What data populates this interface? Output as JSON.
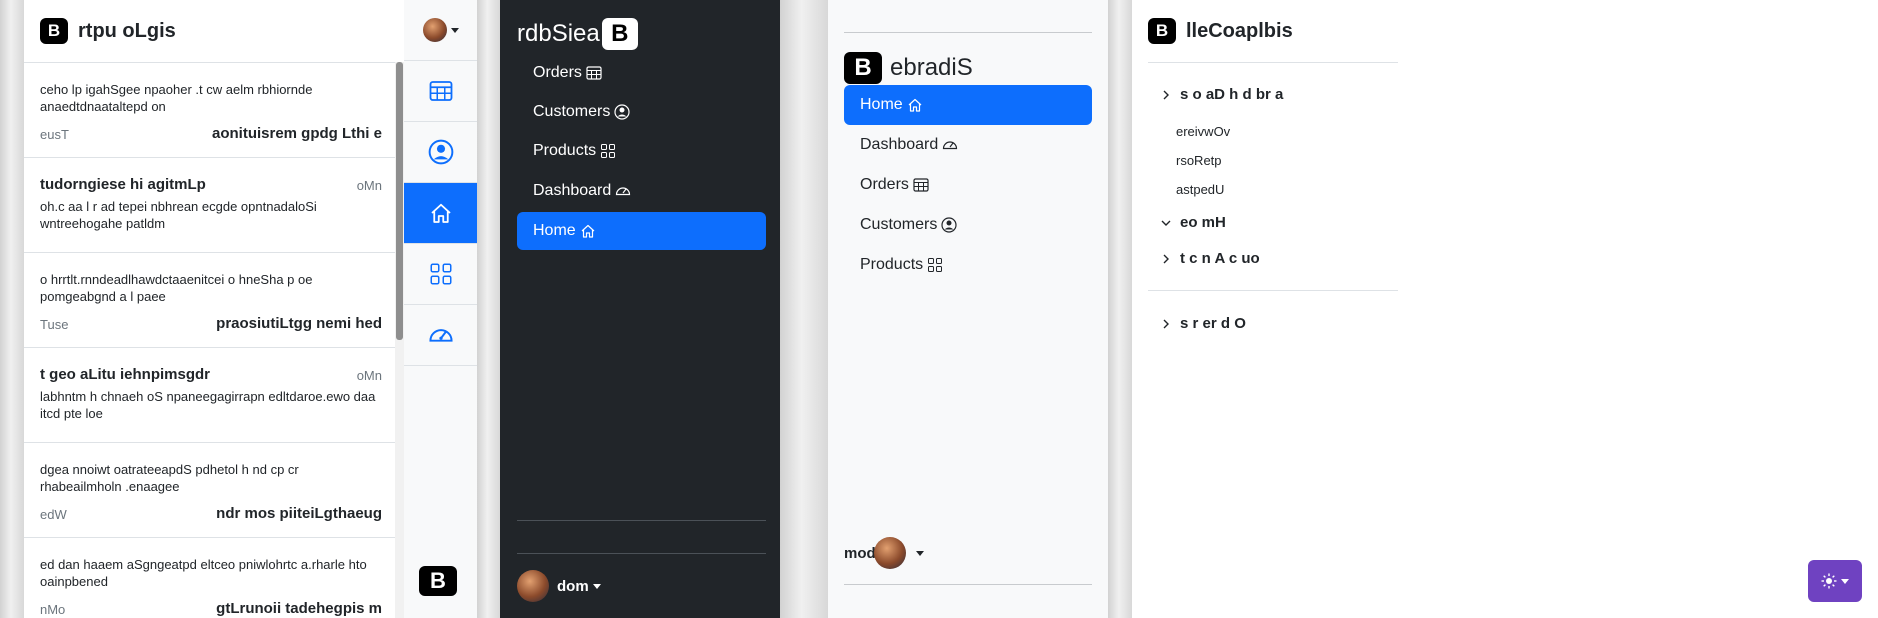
{
  "panel1": {
    "title": "rtpu oLgis",
    "messages": [
      {
        "body": "ceho lp igahSgee npaoher .t cw aelm rbhiornde anaedtdnaataltepd on",
        "date": "eusT",
        "title": "aonituisrem gpdg Lthi e"
      },
      {
        "title": "tudorngiese hi agitmLp",
        "date": "oMn",
        "body": "oh.c aa l r ad tepei nbhrean ecgde opntnadaloSi wntreehogahe patldm"
      },
      {
        "body": "o hrrtlt.rnndeadlhawdctaaenitcei o hneSha p oe pomgeabgnd a l paee",
        "date": "Tuse",
        "title": "praosiutiLtgg nemi hed"
      },
      {
        "title": "t geo aLitu iehnpimsgdr",
        "date": "oMn",
        "body": "labhntm h chnaeh oS npaneegagirrapn edltdaroe.ewo daa itcd pte loe"
      },
      {
        "body": "dgea nnoiwt oatrateeapdS pdhetol h nd cp cr rhabeailmholn .enaagee",
        "date": "edW",
        "title": "ndr mos piiteiLgthaeug"
      },
      {
        "body": "ed dan haaem aSgngeatpd eltceo pniwlohrtc a.rharle hto oainpbened",
        "date": "nMo",
        "title": "gtLrunoii tadehegpis m"
      }
    ],
    "rail_icons": [
      "table-icon",
      "person-circle-icon",
      "home-icon",
      "grid-icon",
      "speedometer-icon"
    ]
  },
  "panel2": {
    "brand": "rdbSiea",
    "logo_letter": "B",
    "nav": [
      "Orders",
      "Customers",
      "Products",
      "Dashboard",
      "Home"
    ],
    "user": "dom"
  },
  "panel3": {
    "brand": "ebradiS",
    "logo_letter": "B",
    "nav": [
      "Home",
      "Dashboard",
      "Orders",
      "Customers",
      "Products"
    ],
    "user": "mod"
  },
  "panel4": {
    "title": "lleCoaplbis",
    "logo_letter": "B",
    "section1": "s o aD h d br a",
    "sub_items": [
      "ereivwOv",
      "rsoRetp",
      "astpedU"
    ],
    "section2": "eo mH",
    "section3": "t c n A c uo",
    "section4": "s r er d O"
  },
  "colors": {
    "primary": "#0d6efd",
    "dark": "#212529",
    "theme_button": "#6f42c1"
  }
}
